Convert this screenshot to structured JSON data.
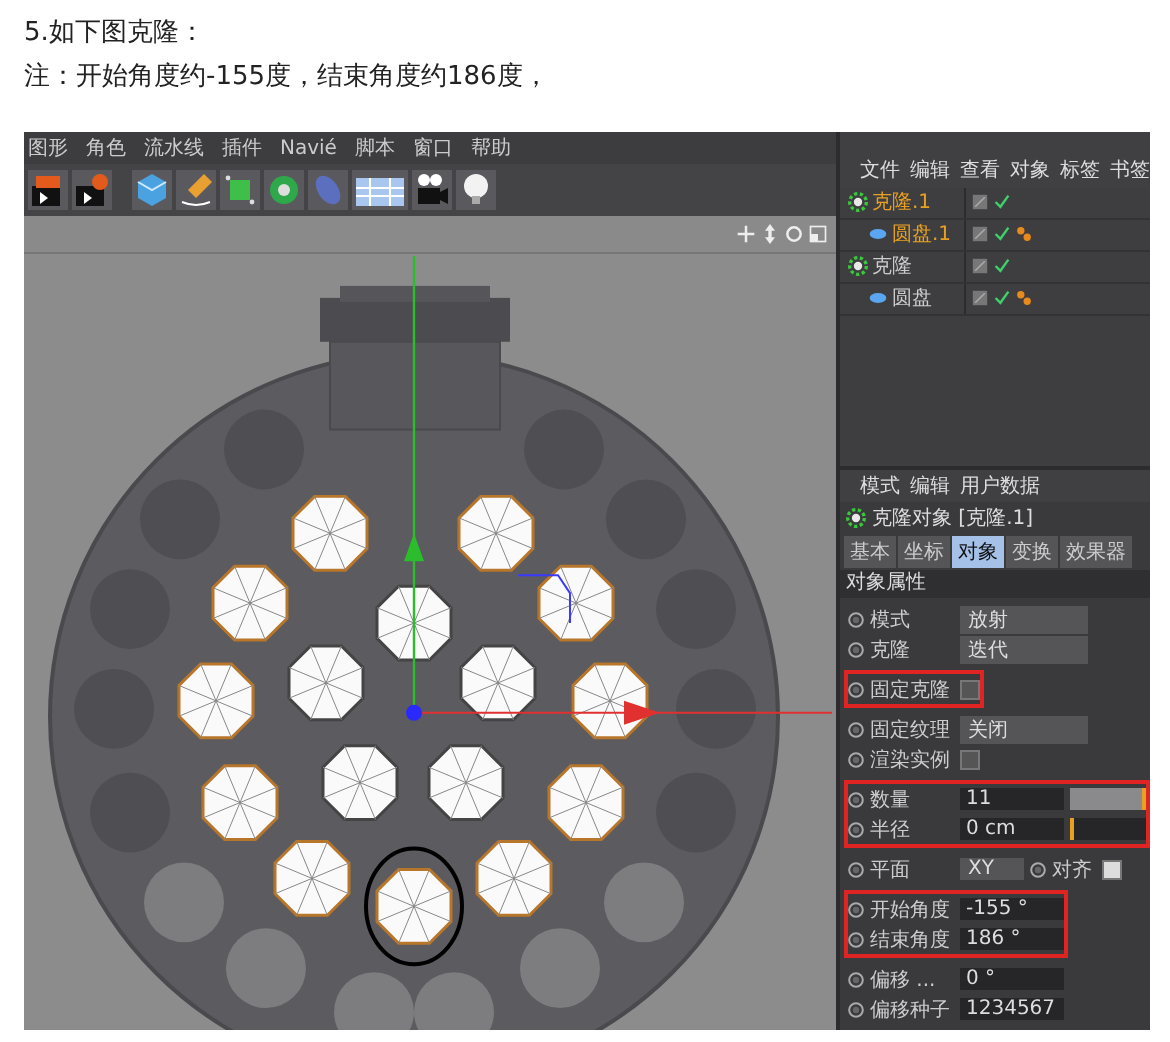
{
  "article": {
    "heading_number": "5.",
    "heading": "如下图克隆：",
    "note": "注：开始角度约-155度，结束角度约186度，"
  },
  "menu": [
    "图形",
    "角色",
    "流水线",
    "插件",
    "Navié",
    "脚本",
    "窗口",
    "帮助"
  ],
  "object_manager": {
    "menu": [
      "文件",
      "编辑",
      "查看",
      "对象",
      "标签",
      "书签"
    ],
    "tree": [
      {
        "name": "克隆.1",
        "kind": "cloner",
        "selected": true,
        "children": [
          {
            "name": "圆盘.1",
            "kind": "disc",
            "selected": true
          }
        ]
      },
      {
        "name": "克隆",
        "kind": "cloner",
        "selected": false,
        "children": [
          {
            "name": "圆盘",
            "kind": "disc",
            "selected": false
          }
        ]
      }
    ]
  },
  "attributes": {
    "menu": [
      "模式",
      "编辑",
      "用户数据"
    ],
    "title": "克隆对象 [克隆.1]",
    "tabs": [
      {
        "label": "基本",
        "selected": false
      },
      {
        "label": "坐标",
        "selected": false
      },
      {
        "label": "对象",
        "selected": true
      },
      {
        "label": "变换",
        "selected": false
      },
      {
        "label": "效果器",
        "selected": false
      }
    ],
    "section": "对象属性",
    "groups": [
      {
        "highlighted": false,
        "rows": [
          {
            "kind": "dropdown",
            "label": "模式",
            "value": "放射"
          },
          {
            "kind": "dropdown",
            "label": "克隆",
            "value": "迭代"
          }
        ]
      },
      {
        "highlighted": true,
        "rows": [
          {
            "kind": "checkbox",
            "label": "固定克隆",
            "checked": false
          }
        ]
      },
      {
        "highlighted": false,
        "rows": [
          {
            "kind": "dropdown",
            "label": "固定纹理",
            "value": "关闭"
          },
          {
            "kind": "checkbox",
            "label": "渲染实例",
            "checked": false
          }
        ]
      },
      {
        "highlighted": true,
        "rows": [
          {
            "kind": "slider",
            "label": "数量",
            "value": "11",
            "level": 1
          },
          {
            "kind": "slider",
            "label": "半径",
            "value": "0 cm",
            "level": 0
          }
        ]
      },
      {
        "highlighted": false,
        "rows": [
          {
            "kind": "plane",
            "label": "平面",
            "value": "XY",
            "label2": "对齐",
            "checked": true
          }
        ]
      },
      {
        "highlighted": true,
        "rows": [
          {
            "kind": "number",
            "label": "开始角度",
            "value": "-155 °"
          },
          {
            "kind": "number",
            "label": "结束角度",
            "value": "186 °"
          }
        ]
      },
      {
        "highlighted": false,
        "rows": [
          {
            "kind": "number",
            "label": "偏移 ...",
            "value": "0 °"
          },
          {
            "kind": "number",
            "label": "偏移种子",
            "value": "1234567"
          }
        ]
      }
    ]
  }
}
